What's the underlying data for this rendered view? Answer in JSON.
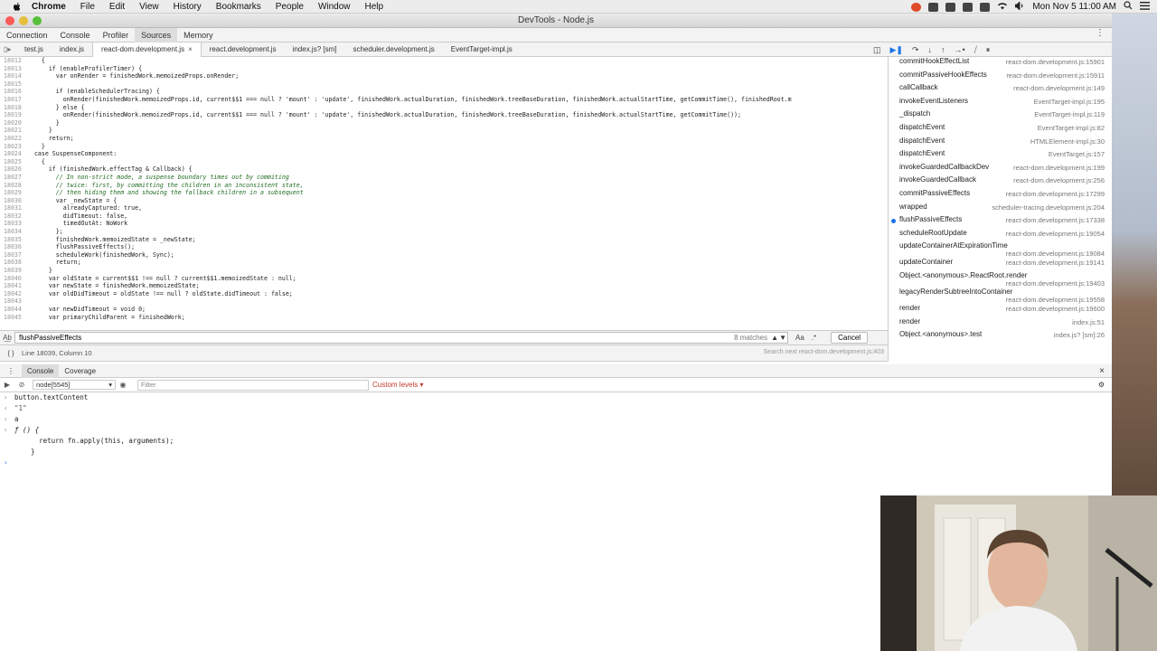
{
  "menubar": {
    "app": "Chrome",
    "items": [
      "File",
      "Edit",
      "View",
      "History",
      "Bookmarks",
      "People",
      "Window",
      "Help"
    ],
    "clock": "Mon Nov 5  11:00 AM"
  },
  "window": {
    "title": "DevTools - Node.js"
  },
  "panel_tabs": [
    "Connection",
    "Console",
    "Profiler",
    "Sources",
    "Memory"
  ],
  "file_tabs": [
    {
      "label": "test.js"
    },
    {
      "label": "index.js"
    },
    {
      "label": "react-dom.development.js",
      "active": true
    },
    {
      "label": "react.development.js"
    },
    {
      "label": "index.js? [sm]"
    },
    {
      "label": "scheduler.development.js"
    },
    {
      "label": "EventTarget-impl.js"
    }
  ],
  "code": [
    {
      "n": "18012",
      "t": "    {"
    },
    {
      "n": "18013",
      "t": "      if (enableProfilerTimer) {"
    },
    {
      "n": "18014",
      "t": "        var onRender = finishedWork.memoizedProps.onRender;"
    },
    {
      "n": "18015",
      "t": ""
    },
    {
      "n": "18016",
      "t": "        if (enableSchedulerTracing) {"
    },
    {
      "n": "18017",
      "t": "          onRender(finishedWork.memoizedProps.id, current$$1 === null ? 'mount' : 'update', finishedWork.actualDuration, finishedWork.treeBaseDuration, finishedWork.actualStartTime, getCommitTime(), finishedRoot.m"
    },
    {
      "n": "18018",
      "t": "        } else {"
    },
    {
      "n": "18019",
      "t": "          onRender(finishedWork.memoizedProps.id, current$$1 === null ? 'mount' : 'update', finishedWork.actualDuration, finishedWork.treeBaseDuration, finishedWork.actualStartTime, getCommitTime());"
    },
    {
      "n": "18020",
      "t": "        }"
    },
    {
      "n": "18021",
      "t": "      }"
    },
    {
      "n": "18022",
      "t": "      return;"
    },
    {
      "n": "18023",
      "t": "    }"
    },
    {
      "n": "18024",
      "t": "  case SuspenseComponent:"
    },
    {
      "n": "18025",
      "t": "    {"
    },
    {
      "n": "18026",
      "t": "      if (finishedWork.effectTag & Callback) {"
    },
    {
      "n": "18027",
      "t": "        // In non-strict mode, a suspense boundary times out by commiting"
    },
    {
      "n": "18028",
      "t": "        // twice: first, by committing the children in an inconsistent state,"
    },
    {
      "n": "18029",
      "t": "        // then hiding them and showing the fallback children in a subsequent"
    },
    {
      "n": "18030",
      "t": "        var _newState = {"
    },
    {
      "n": "18031",
      "t": "          alreadyCaptured: true,"
    },
    {
      "n": "18032",
      "t": "          didTimeout: false,"
    },
    {
      "n": "18033",
      "t": "          timedOutAt: NoWork"
    },
    {
      "n": "18034",
      "t": "        };"
    },
    {
      "n": "18035",
      "t": "        finishedWork.memoizedState = _newState;"
    },
    {
      "n": "18036",
      "t": "        flushPassiveEffects();"
    },
    {
      "n": "18037",
      "t": "        scheduleWork(finishedWork, Sync);"
    },
    {
      "n": "18038",
      "t": "        return;"
    },
    {
      "n": "18039",
      "t": "      }"
    },
    {
      "n": "18040",
      "t": "      var oldState = current$$1 !== null ? current$$1.memoizedState : null;"
    },
    {
      "n": "18041",
      "t": "      var newState = finishedWork.memoizedState;"
    },
    {
      "n": "18042",
      "t": "      var oldDidTimeout = oldState !== null ? oldState.didTimeout : false;"
    },
    {
      "n": "18043",
      "t": ""
    },
    {
      "n": "18044",
      "t": "      var newDidTimeout = void 0;"
    },
    {
      "n": "18045",
      "t": "      var primaryChildParent = finishedWork;"
    }
  ],
  "callstack": [
    {
      "fn": "commitHookEffectList",
      "loc": "react-dom.development.js:15901"
    },
    {
      "fn": "commitPassiveHookEffects",
      "loc": "react-dom.development.js:15911"
    },
    {
      "fn": "callCallback",
      "loc": "react-dom.development.js:149"
    },
    {
      "fn": "invokeEventListeners",
      "loc": "EventTarget-impl.js:195"
    },
    {
      "fn": "_dispatch",
      "loc": "EventTarget-impl.js:119"
    },
    {
      "fn": "dispatchEvent",
      "loc": "EventTarget-impl.js:82"
    },
    {
      "fn": "dispatchEvent",
      "loc": "HTMLElement-impl.js:30"
    },
    {
      "fn": "dispatchEvent",
      "loc": "EventTarget.js:157"
    },
    {
      "fn": "invokeGuardedCallbackDev",
      "loc": "react-dom.development.js:199"
    },
    {
      "fn": "invokeGuardedCallback",
      "loc": "react-dom.development.js:256"
    },
    {
      "fn": "commitPassiveEffects",
      "loc": "react-dom.development.js:17299"
    },
    {
      "fn": "wrapped",
      "loc": "scheduler-tracing.development.js:204"
    },
    {
      "fn": "flushPassiveEffects",
      "loc": "react-dom.development.js:17338",
      "current": true
    },
    {
      "fn": "scheduleRootUpdate",
      "loc": "react-dom.development.js:19054"
    },
    {
      "fn": "updateContainerAtExpirationTime",
      "loc": "react-dom.development.js:19084",
      "two": true
    },
    {
      "fn": "updateContainer",
      "loc": "react-dom.development.js:19141"
    },
    {
      "fn": "Object.<anonymous>.ReactRoot.render",
      "loc": "react-dom.development.js:19403",
      "two": true
    },
    {
      "fn": "legacyRenderSubtreeIntoContainer",
      "loc": "react-dom.development.js:19558",
      "two": true
    },
    {
      "fn": "render",
      "loc": "react-dom.development.js:19600"
    },
    {
      "fn": "render",
      "loc": "index.js:51"
    },
    {
      "fn": "Object.<anonymous>.test",
      "loc": "index.js? [sm]:26"
    }
  ],
  "search": {
    "value": "flushPassiveEffects",
    "matches": "8 matches",
    "case_label": "Aa",
    "regex_label": ".*",
    "cancel_label": "Cancel",
    "hint": "Search next"
  },
  "status": {
    "position": "Line 18039, Column 10",
    "hint_loc": "react-dom.development.js:403"
  },
  "drawer_tabs": [
    "Console",
    "Coverage"
  ],
  "console_toolbar": {
    "context": "node[5545]",
    "filter_placeholder": "Filter",
    "levels": "Custom levels"
  },
  "console_lines": [
    {
      "kind": "input",
      "text": "button.textContent"
    },
    {
      "kind": "result",
      "text": "\"1\""
    },
    {
      "kind": "input",
      "text": "a"
    },
    {
      "kind": "fn",
      "text": "ƒ () {"
    },
    {
      "kind": "code",
      "text": "      return fn.apply(this, arguments);"
    },
    {
      "kind": "code",
      "text": "    }"
    }
  ],
  "colors": {
    "accent": "#1a73e8",
    "keyword": "#a21a91",
    "string": "#c41a16",
    "comment": "#236e25"
  }
}
